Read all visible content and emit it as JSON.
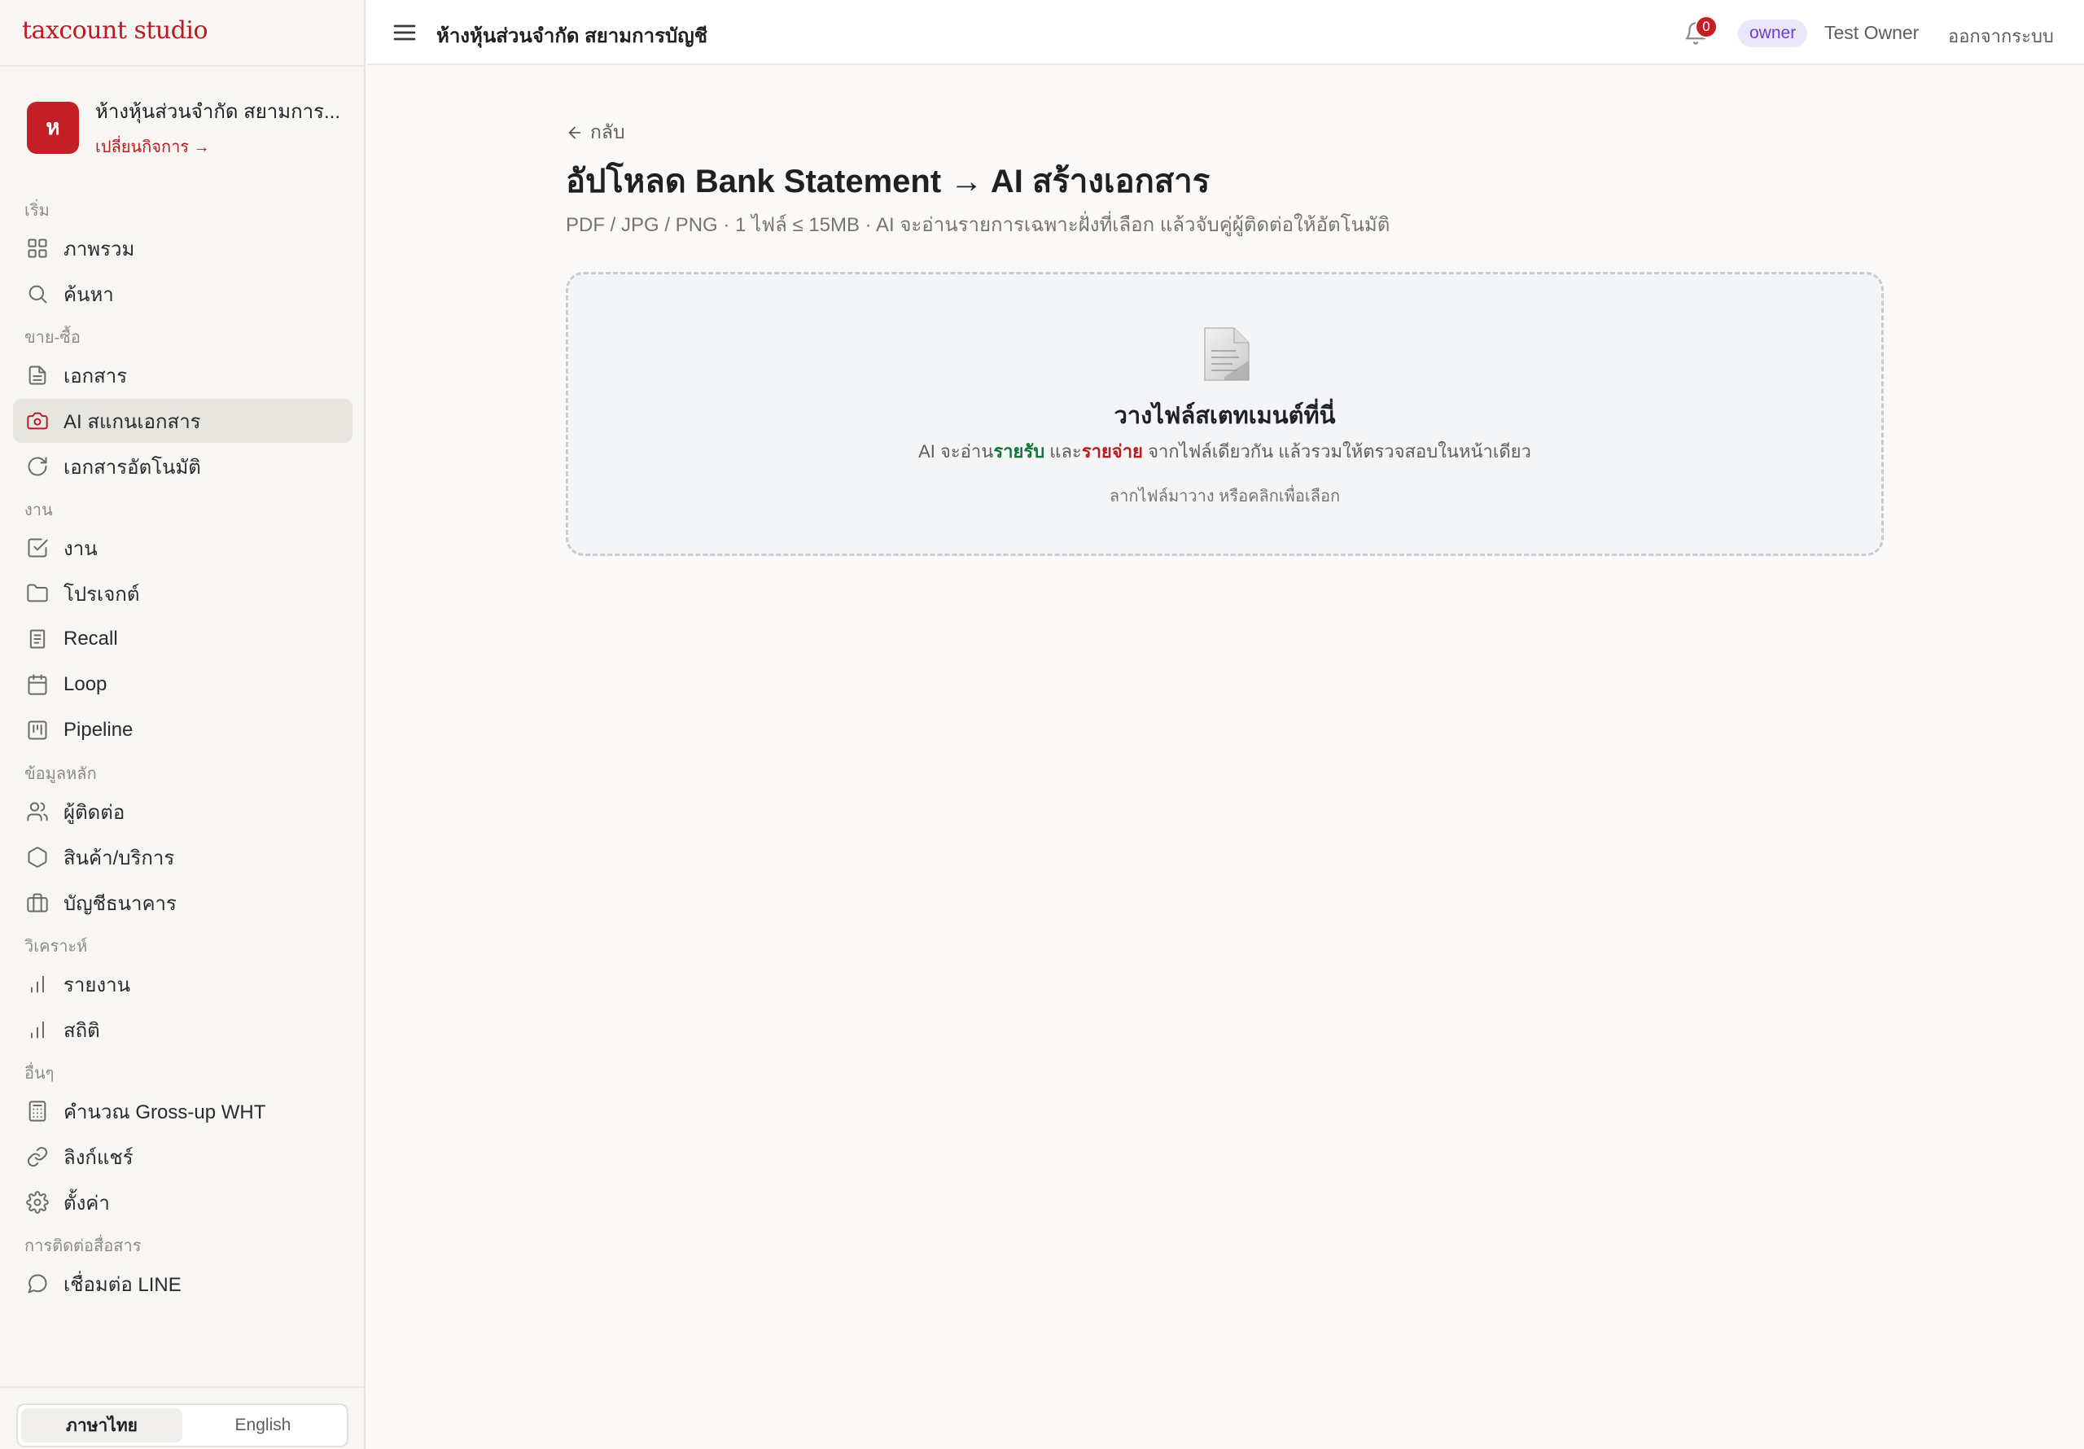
{
  "brand": "taxcount studio",
  "business": {
    "avatar_letter": "ห",
    "name": "ห้างหุ้นส่วนจำกัด สยามการ...",
    "switch_label": "เปลี่ยนกิจการ →"
  },
  "nav": {
    "sections": [
      {
        "label": "เริ่ม",
        "items": [
          {
            "label": "ภาพรวม",
            "icon": "grid-icon"
          },
          {
            "label": "ค้นหา",
            "icon": "search-icon"
          }
        ]
      },
      {
        "label": "ขาย-ซื้อ",
        "items": [
          {
            "label": "เอกสาร",
            "icon": "document-icon"
          },
          {
            "label": "AI สแกนเอกสาร",
            "icon": "camera-icon",
            "active": true
          },
          {
            "label": "เอกสารอัตโนมัติ",
            "icon": "refresh-icon"
          }
        ]
      },
      {
        "label": "งาน",
        "items": [
          {
            "label": "งาน",
            "icon": "check-square-icon"
          },
          {
            "label": "โปรเจกต์",
            "icon": "folder-icon"
          },
          {
            "label": "Recall",
            "icon": "receipt-icon"
          },
          {
            "label": "Loop",
            "icon": "calendar-icon"
          },
          {
            "label": "Pipeline",
            "icon": "kanban-icon"
          }
        ]
      },
      {
        "label": "ข้อมูลหลัก",
        "items": [
          {
            "label": "ผู้ติดต่อ",
            "icon": "users-icon"
          },
          {
            "label": "สินค้า/บริการ",
            "icon": "hexagon-icon"
          },
          {
            "label": "บัญชีธนาคาร",
            "icon": "briefcase-icon"
          }
        ]
      },
      {
        "label": "วิเคราะห์",
        "items": [
          {
            "label": "รายงาน",
            "icon": "bar-chart-icon"
          },
          {
            "label": "สถิติ",
            "icon": "bar-chart-icon"
          }
        ]
      },
      {
        "label": "อื่นๆ",
        "items": [
          {
            "label": "คำนวณ Gross-up WHT",
            "icon": "calculator-icon"
          },
          {
            "label": "ลิงก์แชร์",
            "icon": "link-icon"
          },
          {
            "label": "ตั้งค่า",
            "icon": "gear-icon"
          }
        ]
      },
      {
        "label": "การติดต่อสื่อสาร",
        "items": [
          {
            "label": "เชื่อมต่อ LINE",
            "icon": "chat-icon"
          }
        ]
      }
    ]
  },
  "language": {
    "thai": "ภาษาไทย",
    "english": "English",
    "active": "thai"
  },
  "topbar": {
    "title": "ห้างหุ้นส่วนจำกัด สยามการบัญชี",
    "notification_count": "0",
    "role": "owner",
    "user": "Test Owner",
    "logout": "ออกจากระบบ"
  },
  "main": {
    "back": "กลับ",
    "title": "อัปโหลด Bank Statement → AI สร้างเอกสาร",
    "subtitle": "PDF / JPG / PNG · 1 ไฟล์ ≤ 15MB · AI จะอ่านรายการเฉพาะฝั่งที่เลือก แล้วจับคู่ผู้ติดต่อให้อัตโนมัติ",
    "dropzone": {
      "title": "วางไฟล์สเตทเมนต์ที่นี่",
      "desc_prefix": "AI จะอ่าน",
      "income": "รายรับ",
      "desc_and": " และ",
      "expense": "รายจ่าย",
      "desc_suffix": " จากไฟล์เดียวกัน แล้วรวมให้ตรวจสอบในหน้าเดียว",
      "hint": "ลากไฟล์มาวาง หรือคลิกเพื่อเลือก"
    }
  },
  "colors": {
    "accent": "#b81c22",
    "income": "#16743a",
    "role_badge": "#6a3fc8"
  }
}
